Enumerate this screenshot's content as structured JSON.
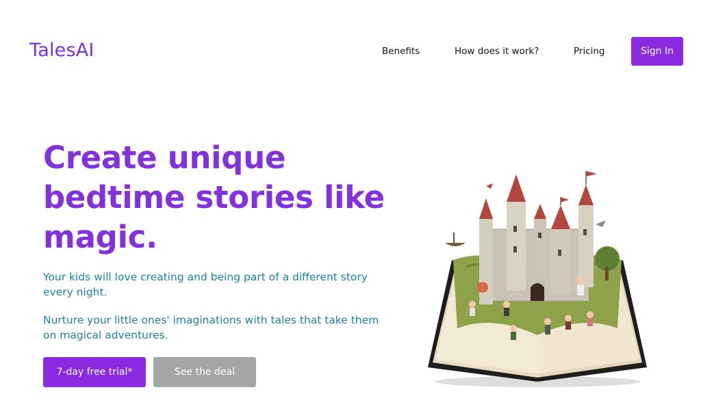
{
  "header": {
    "logo": "TalesAI",
    "nav": [
      {
        "label": "Benefits"
      },
      {
        "label": "How does it work?"
      },
      {
        "label": "Pricing"
      }
    ],
    "signin_label": "Sign In"
  },
  "hero": {
    "headline": "Create unique bedtime stories like magic.",
    "subtitle1": "Your kids will love creating and being part of a different story every night.",
    "subtitle2": "Nurture your little ones' imaginations with tales that take them on magical adventures.",
    "cta_primary": "7-day free trial*",
    "cta_secondary": "See the deal"
  },
  "colors": {
    "brand_purple": "#8a2be2",
    "headline_purple": "#8232dd",
    "text_teal": "#1a7fa3",
    "secondary_button": "#a6a6a6"
  },
  "icons": {
    "illustration": "pop-up-storybook-castle-illustration"
  }
}
